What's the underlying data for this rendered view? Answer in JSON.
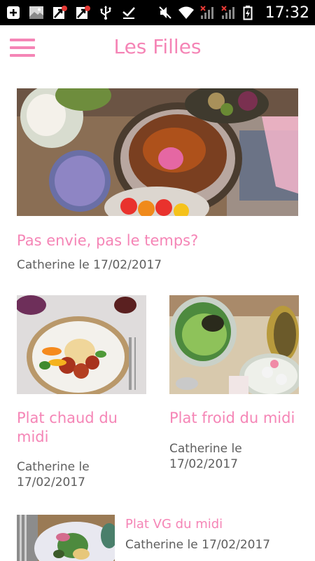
{
  "status_bar": {
    "time": "17:32",
    "icons": [
      "add-box-icon",
      "image-icon",
      "missed-notification-icon",
      "missed-notification-icon",
      "usb-icon",
      "download-done-icon",
      "mute-icon",
      "wifi-icon",
      "no-signal-icon",
      "no-signal-icon",
      "battery-charging-icon"
    ]
  },
  "app_bar": {
    "title": "Les Filles",
    "menu_icon": "hamburger-menu-icon",
    "accent_color": "#f585b6"
  },
  "articles": [
    {
      "title": "Pas envie, pas le temps?",
      "meta": "Catherine le 17/02/2017"
    },
    {
      "title": "Plat chaud du midi",
      "meta": "Catherine le 17/02/2017"
    },
    {
      "title": "Plat froid du midi",
      "meta": "Catherine le 17/02/2017"
    },
    {
      "title": "Plat VG du midi",
      "meta": "Catherine le 17/02/2017"
    }
  ]
}
